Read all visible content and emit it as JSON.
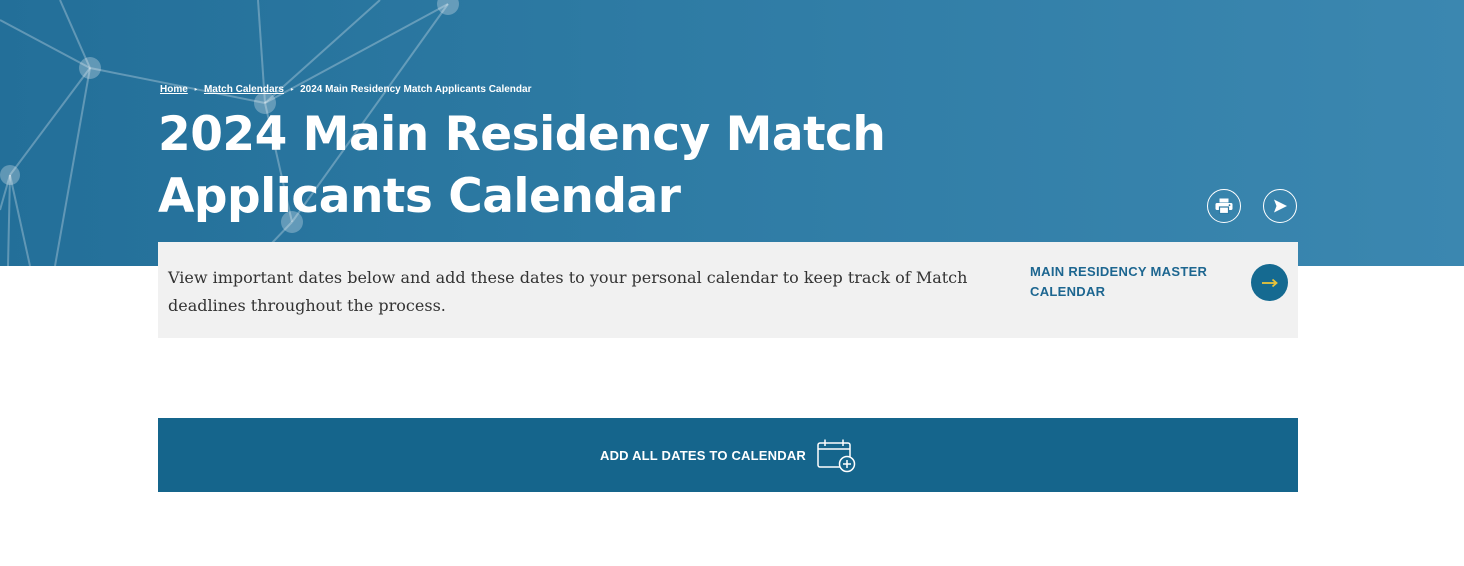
{
  "breadcrumb": {
    "home": "Home",
    "match_calendars": "Match Calendars",
    "current": "2024 Main Residency Match Applicants Calendar",
    "separator": "‣"
  },
  "page_title": "2024 Main Residency Match Applicants Calendar",
  "actions": {
    "print_icon": "printer-icon",
    "share_icon": "send-icon"
  },
  "intro": {
    "text": "View important dates below and add these dates to your personal calendar to keep track of Match deadlines throughout the process.",
    "link_label": "MAIN RESIDENCY MASTER CALENDAR",
    "link_icon": "arrow-right-icon"
  },
  "cta": {
    "label": "ADD ALL DATES TO CALENDAR",
    "icon": "calendar-add-icon"
  },
  "colors": {
    "hero_bg": "#2e7ba4",
    "cta_bg": "#15658c",
    "link_text": "#1d6690",
    "arrow_accent": "#e8c33a",
    "intro_bg": "#f1f1f1"
  }
}
